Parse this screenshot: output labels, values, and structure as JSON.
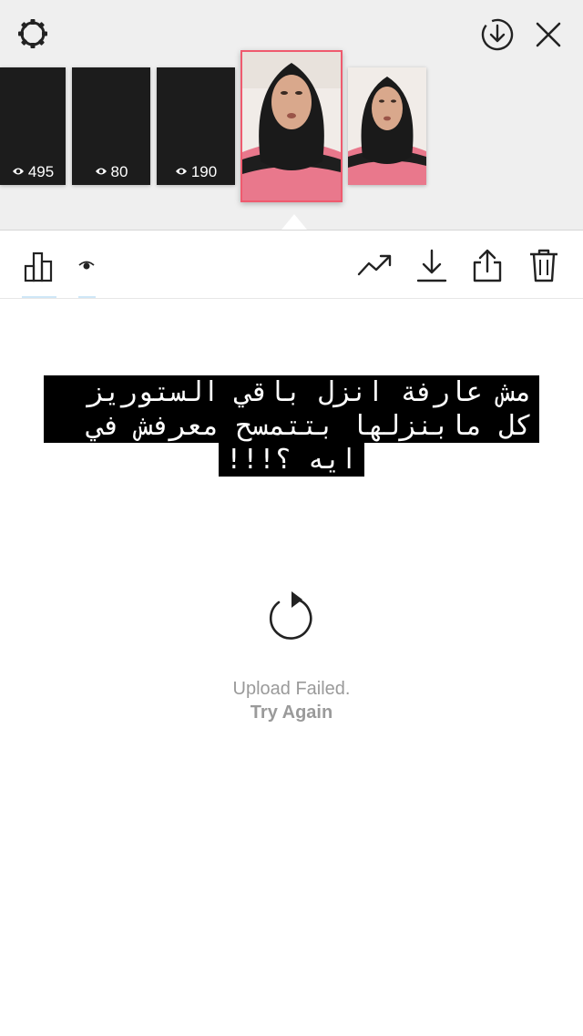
{
  "header": {
    "settings_icon": "gear-icon",
    "save_icon": "download-circle-icon",
    "close_icon": "close-icon"
  },
  "stories": [
    {
      "views": "495"
    },
    {
      "views": "80"
    },
    {
      "views": "190"
    }
  ],
  "toolbar": {
    "insights_icon": "bar-chart-icon",
    "viewers_icon": "eye-icon",
    "promote_icon": "trend-up-icon",
    "download_icon": "download-icon",
    "share_icon": "share-icon",
    "delete_icon": "trash-icon"
  },
  "caption": {
    "line1": "مش عارفة انزل باقي الستوريز",
    "line2": "كل مابنزلها بتتمسح معرفش في",
    "line3": "ايه ؟!!!"
  },
  "upload": {
    "status": "Upload Failed.",
    "action": "Try Again"
  },
  "colors": {
    "selected_border": "#ef5a6e",
    "top_background": "#efefef",
    "status_text": "#9a9a9a"
  }
}
